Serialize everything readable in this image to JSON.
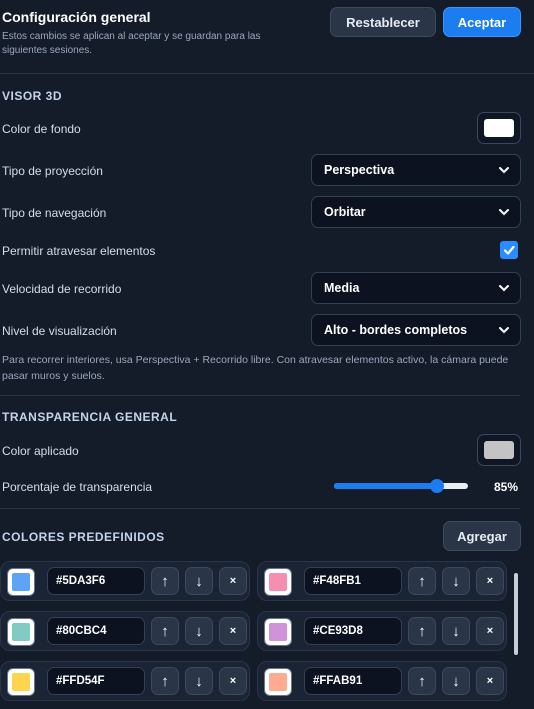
{
  "header": {
    "title": "Configuración general",
    "subtitle": "Estos cambios se aplican al aceptar y se guardan para las siguientes sesiones.",
    "reset_label": "Restablecer",
    "accept_label": "Aceptar"
  },
  "viewer": {
    "section_title": "VISOR 3D",
    "bg_color_label": "Color de fondo",
    "bg_color": "#FFFFFF",
    "projection_label": "Tipo de proyección",
    "projection_value": "Perspectiva",
    "navigation_label": "Tipo de navegación",
    "navigation_value": "Orbitar",
    "pass_through_label": "Permitir atravesar elementos",
    "pass_through_checked": true,
    "speed_label": "Velocidad de recorrido",
    "speed_value": "Media",
    "level_label": "Nivel de visualización",
    "level_value": "Alto - bordes completos",
    "hint": "Para recorrer interiores, usa Perspectiva + Recorrido libre. Con atravesar elementos activo, la cámara puede pasar muros y suelos."
  },
  "transparency": {
    "section_title": "TRANSPARENCIA GENERAL",
    "applied_color_label": "Color aplicado",
    "applied_color": "#C4C4C4",
    "percent_label": "Porcentaje de transparencia",
    "percent_value": 85,
    "percent_text": "85%"
  },
  "presets": {
    "section_title": "COLORES PREDEFINIDOS",
    "add_label": "Agregar",
    "up_icon": "↑",
    "down_icon": "↓",
    "delete_icon": "×",
    "items": [
      {
        "hex": "#5DA3F6"
      },
      {
        "hex": "#F48FB1"
      },
      {
        "hex": "#80CBC4"
      },
      {
        "hex": "#CE93D8"
      },
      {
        "hex": "#FFD54F"
      },
      {
        "hex": "#FFAB91"
      }
    ]
  },
  "colors": {
    "accent": "#1B7DF0",
    "background": "#141C2A"
  }
}
